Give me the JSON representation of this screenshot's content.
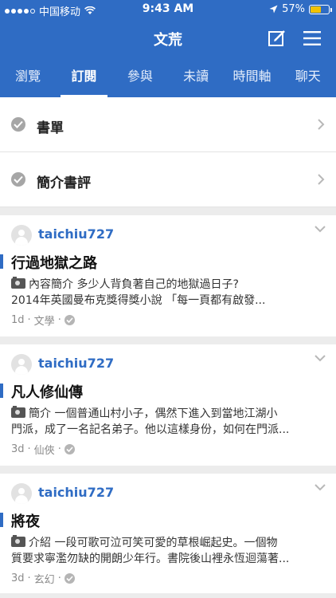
{
  "status_bar": {
    "carrier": "中国移动",
    "time": "9:43 AM",
    "battery_text": "57%",
    "battery_level": 0.57,
    "signal_bars": 4
  },
  "header": {
    "title": "文荒"
  },
  "tabs": [
    {
      "label": "瀏覽",
      "active": false
    },
    {
      "label": "訂閱",
      "active": true
    },
    {
      "label": "參與",
      "active": false
    },
    {
      "label": "未讀",
      "active": false
    },
    {
      "label": "時間軸",
      "active": false
    },
    {
      "label": "聊天",
      "active": false
    }
  ],
  "topics": [
    {
      "label": "書單"
    },
    {
      "label": "簡介書評"
    }
  ],
  "posts": [
    {
      "author": "taichiu727",
      "title": "行過地獄之路",
      "excerpt_line1": "內容簡介  多少人背負著自己的地獄過日子?",
      "excerpt_line2": "2014年英國曼布克獎得獎小說        「每一頁都有啟發...",
      "age": "1d",
      "category": "文學"
    },
    {
      "author": "taichiu727",
      "title": "凡人修仙傳",
      "excerpt_line1": "簡介  一個普通山村小子，偶然下進入到當地江湖小",
      "excerpt_line2": "門派，成了一名記名弟子。他以這樣身份，如何在門派...",
      "age": "3d",
      "category": "仙俠"
    },
    {
      "author": "taichiu727",
      "title": "將夜",
      "excerpt_line1": "介紹  一段可歌可泣可笑可愛的草根崛起史。一個物",
      "excerpt_line2": "質要求寧濫勿缺的開朗少年行。書院後山裡永恆迴蕩著...",
      "age": "3d",
      "category": "玄幻"
    }
  ],
  "colors": {
    "brand": "#2f6cc4",
    "battery": "#f2c200"
  },
  "icons": {
    "compose": "compose-icon",
    "menu": "hamburger-menu-icon",
    "check": "check-circle-icon",
    "chevron": "chevron-right-icon",
    "caret": "chevron-down-icon",
    "camera": "camera-icon",
    "avatar": "default-avatar-icon"
  }
}
